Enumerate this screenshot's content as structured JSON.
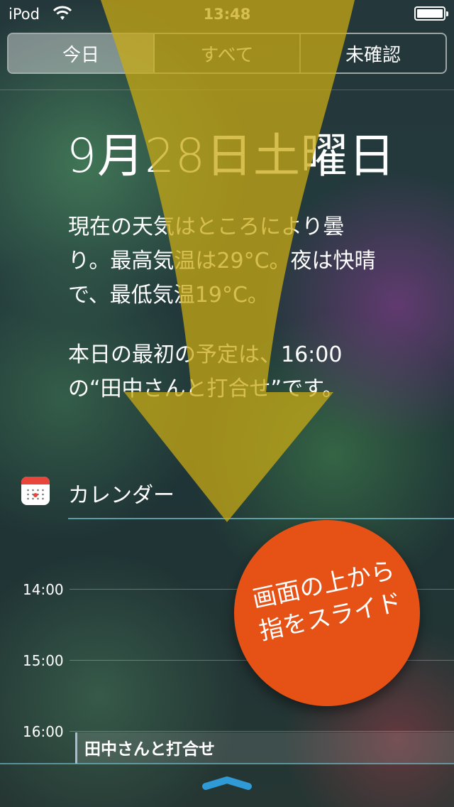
{
  "status": {
    "device": "iPod",
    "time": "13:48"
  },
  "tabs": [
    {
      "label": "今日",
      "active": true
    },
    {
      "label": "すべて",
      "active": false
    },
    {
      "label": "未確認",
      "active": false
    }
  ],
  "today": {
    "date": "9月28日土曜日",
    "weather": "現在の天気はところにより曇\nり。最高気温は29°C。夜は快晴\nで、最低気温19°C。",
    "schedule": "本日の最初の予定は、16:00\nの“田中さんと打合せ”です。"
  },
  "calendar": {
    "title": "カレンダー",
    "hours": [
      "14:00",
      "15:00",
      "16:00"
    ],
    "event": "田中さんと打合せ"
  },
  "callout": {
    "text": "画面の上から\n指をスライド"
  },
  "colors": {
    "arrow": "#c8ad14",
    "badge": "#e65116",
    "accent_line": "#78c8d7",
    "grabber": "#2f9ad6"
  }
}
